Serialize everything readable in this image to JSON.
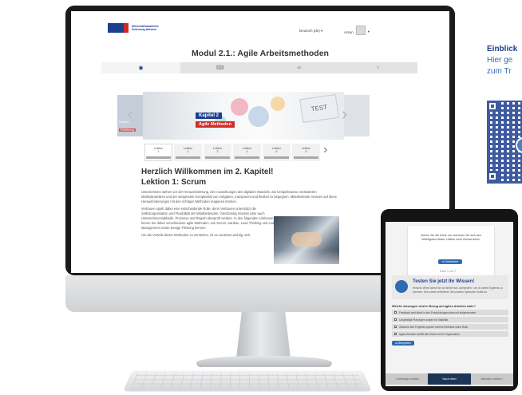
{
  "app": {
    "logo_text_line1": "Wirtschaftsakademie",
    "logo_text_line2": "Schleswig-Holstein",
    "lang_menu": "Deutsch (de) ▾",
    "user_label": "Antun",
    "user_chevron": "▾"
  },
  "module": {
    "title": "Modul 2.1.: Agile Arbeitsmethoden"
  },
  "tabs": [
    {
      "icon": "eye-icon",
      "glyph": "◉"
    },
    {
      "icon": "keyboard-icon",
      "glyph": "⌨"
    },
    {
      "icon": "share-icon",
      "glyph": "⋖"
    },
    {
      "icon": "trophy-icon",
      "glyph": "♆"
    }
  ],
  "slider": {
    "prev_glyph": "‹",
    "next_glyph": "›",
    "left_slide_title": "Kapitel 1",
    "left_slide_badge": "Einführung",
    "chapter_label": "Kapitel 2",
    "chapter_subtitle": "Agile Methoden",
    "card_label": "TEST"
  },
  "lessons": [
    {
      "line1": "Lektion",
      "line2": "1"
    },
    {
      "line1": "Lektion",
      "line2": "2"
    },
    {
      "line1": "Lektion",
      "line2": "3"
    },
    {
      "line1": "Lektion",
      "line2": "4"
    },
    {
      "line1": "Lektion",
      "line2": "5"
    },
    {
      "line1": "Lektion",
      "line2": "6"
    }
  ],
  "lessons_next_glyph": "›",
  "article": {
    "welcome": "Herzlich Willkommen im 2. Kapitel!",
    "lesson_title": "Lektion 1: Scrum",
    "para1": "Unternehmen stehen vor der Herausforderung, den Auswirkungen des digitalen Wandels, wie beispielsweise veränderten Marktdynamiken und der steigenden Komplexität von Aufgaben, transparent und flexibel zu begegnen. Mitarbeitende müssen auf diese Herausforderungen mit den richtigen Methoden reagieren können.",
    "para2": "Vertrauen spielt dabei eine entscheidende Rolle, denn Vertrauen unterstützt die Selbstorganisation und Flexibilität der Mitarbeitenden. Gleichzeitig müssen aber auch Unternehmensabläufe, Prozesse und Regeln überprüft werden. In den folgenden Lektionen lernen Sie daher verschiedene agile Methoden, wie Scrum, Kanban, Lean Thinking und Lean Management sowie Design Thinking kennen.",
    "para3": "Um die Vorteile dieser Methoden zu verstehen, ist es zunächst wichtig, sich"
  },
  "side_info": {
    "title": "Einblick",
    "line1": "Hier ge",
    "line2": "zum Tr"
  },
  "tablet": {
    "card_text": "Ziehen Sie die Karte um und lesen Sie sich den Wichtigsten dieser Lektion noch einmal durch.",
    "card_button": "● Umdrehen",
    "pager": "Karte 1 von 7",
    "quiz_title": "Testen Sie jetzt Ihr Wissen!",
    "quiz_text": "Hinweis: Wenn kleine Sie ob Wörter wie „überprüfen“, um zu sehen Ergebnis zu kommen. Drei zweite verifizieren Sie unseren Symbolen Gratis dir.",
    "question": "Welche Aussagen sind in Bezug auf agiles Arbeiten wahr?",
    "options": [
      "Feedback wird direkt in den Entwicklungsprozess mit aufgenommen.",
      "Langfristige Planungen sorgen für Stabilität.",
      "Während des Projektes spielen externe Einflüsse keine Rolle.",
      "Agiles Arbeiten betrifft alle Ebenen einer Organisation."
    ],
    "check_button": "● Überprüfen",
    "footer_prev": "‹ Vorherige Lektion",
    "footer_mid": "Nach oben",
    "footer_next": "Nächste Lektion ›"
  },
  "colors": {
    "brand_blue": "#1d3f8f",
    "accent_red": "#d12b2b",
    "link_blue": "#2f6bb3"
  }
}
